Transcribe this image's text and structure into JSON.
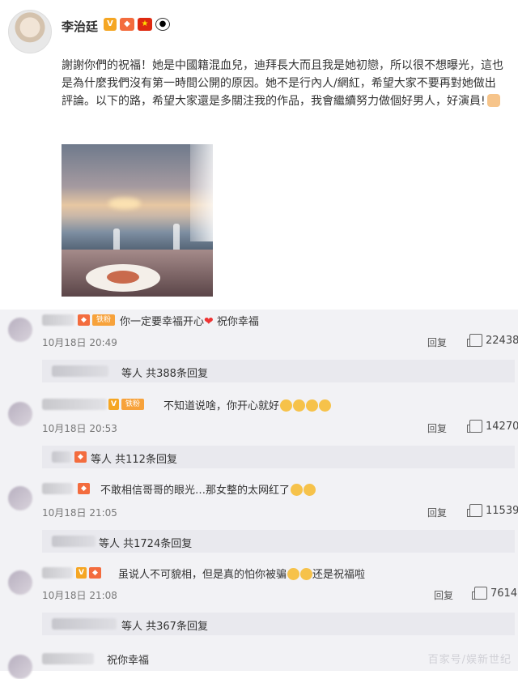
{
  "post": {
    "username": "李治廷",
    "text": "謝謝你們的祝福！她是中國籍混血兒，迪拜長大而且我是她初戀，所以很不想曝光，這也是為什麼我們沒有第一時間公開的原因。她不是行內人/網紅，希望大家不要再對她做出評論。以下的路，希望大家還是多關注我的作品，我會繼續努力做個好男人，好演員!",
    "badges": [
      "v-badge-icon",
      "vip-badge-icon",
      "china-flag-icon",
      "panda-icon"
    ],
    "photo": "sunset-dinner-photo"
  },
  "comments": [
    {
      "text": "你一定要幸福开心",
      "text_after": " 祝你幸福",
      "date": "10月18日 20:49",
      "reply_label": "回复",
      "likes": "22438",
      "replies_text": "等人 共388条回复"
    },
    {
      "text": "不知道说啥，你开心就好",
      "date": "10月18日 20:53",
      "reply_label": "回复",
      "likes": "14270",
      "replies_text": "等人 共112条回复"
    },
    {
      "text": "不敢相信哥哥的眼光…那女整的太网红了",
      "date": "10月18日 21:05",
      "reply_label": "回复",
      "likes": "11539",
      "replies_text": "等人 共1724条回复"
    },
    {
      "text": "虽说人不可貌相，但是真的怕你被骗",
      "text_after": "还是祝福啦",
      "date": "10月18日 21:08",
      "reply_label": "回复",
      "likes": "7614",
      "replies_text": "等人 共367条回复"
    },
    {
      "text": "祝你幸福"
    }
  ],
  "badges": {
    "fan": "铁粉"
  },
  "watermark": "百家号/娱新世纪"
}
